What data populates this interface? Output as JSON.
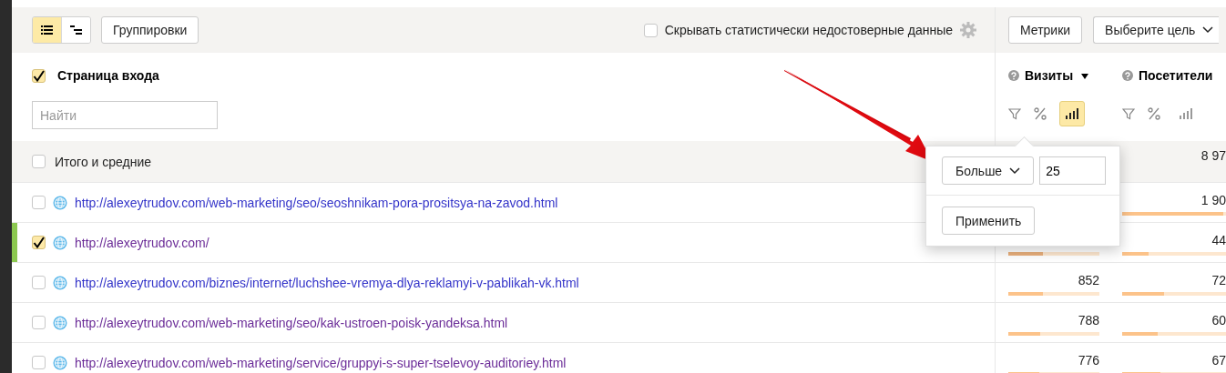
{
  "toolbar": {
    "view_modes": [
      {
        "kind": "list",
        "selected": true
      },
      {
        "kind": "tree",
        "selected": false
      }
    ],
    "groupings_button": "Группировки",
    "hide_unreliable": {
      "label": "Скрывать статистически недостоверные данные",
      "checked": false
    },
    "metrics_button": "Метрики",
    "goal_select": "Выберите цель"
  },
  "dimension": {
    "label": "Страница входа",
    "checked": true,
    "search": {
      "placeholder": "Найти"
    }
  },
  "metrics": [
    {
      "label": "Визиты",
      "sorted": true,
      "chart_mode": true
    },
    {
      "label": "Посетители",
      "sorted": false,
      "chart_mode": false
    }
  ],
  "totals": {
    "label": "Итого и средние",
    "checked": false,
    "visitors": "8 97"
  },
  "rows": [
    {
      "url": "http://alexeytrudov.com/web-marketing/seo/seoshnikam-pora-prositsya-na-zavod.html",
      "visited": false,
      "checked": false,
      "visitors": {
        "value": "1 90",
        "level": 0.97
      }
    },
    {
      "url": "http://alexeytrudov.com/",
      "visited": true,
      "checked": true,
      "visits": {
        "level": 0.38
      },
      "visitors": {
        "value": "44",
        "level": 0.25
      }
    },
    {
      "url": "http://alexeytrudov.com/biznes/internet/luchshee-vremya-dlya-reklamyi-v-pablikah-vk.html",
      "visited": false,
      "checked": false,
      "visits": {
        "value": "852",
        "level": 0.38
      },
      "visitors": {
        "value": "72",
        "level": 0.4
      }
    },
    {
      "url": "http://alexeytrudov.com/web-marketing/seo/kak-ustroen-poisk-yandeksa.html",
      "visited": true,
      "checked": false,
      "visits": {
        "value": "788",
        "level": 0.35
      },
      "visitors": {
        "value": "60",
        "level": 0.34
      }
    },
    {
      "url": "http://alexeytrudov.com/web-marketing/service/gruppyi-s-super-tselevoy-auditoriey.html",
      "visited": true,
      "checked": false,
      "visits": {
        "value": "776",
        "level": 0.34
      },
      "visitors": {
        "value": "67",
        "level": 0.37
      }
    }
  ],
  "filter_popup": {
    "operator": "Больше",
    "value": "25",
    "apply_button": "Применить"
  }
}
